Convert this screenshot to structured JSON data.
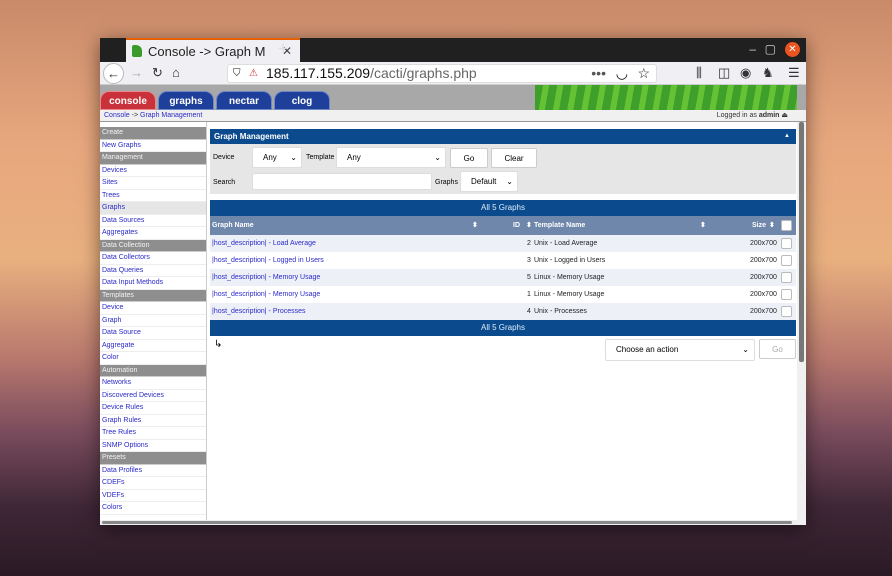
{
  "browser": {
    "tab_title": "Console -> Graph M",
    "url_host": "185.117.155.209",
    "url_path": "/cacti/graphs.php"
  },
  "cacti_tabs": [
    "console",
    "graphs",
    "nectar",
    "clog"
  ],
  "breadcrumb": {
    "root": "Console",
    "sep": "->",
    "current": "Graph Management"
  },
  "logged_in": {
    "prefix": "Logged in as",
    "user": "admin"
  },
  "sidebar": [
    {
      "type": "sec",
      "label": "Create"
    },
    {
      "type": "it",
      "label": "New Graphs"
    },
    {
      "type": "sec",
      "label": "Management"
    },
    {
      "type": "it",
      "label": "Devices"
    },
    {
      "type": "it",
      "label": "Sites"
    },
    {
      "type": "it",
      "label": "Trees"
    },
    {
      "type": "sel",
      "label": "Graphs"
    },
    {
      "type": "it",
      "label": "Data Sources"
    },
    {
      "type": "it",
      "label": "Aggregates"
    },
    {
      "type": "sec",
      "label": "Data Collection"
    },
    {
      "type": "it",
      "label": "Data Collectors"
    },
    {
      "type": "it",
      "label": "Data Queries"
    },
    {
      "type": "it",
      "label": "Data Input Methods"
    },
    {
      "type": "sec",
      "label": "Templates"
    },
    {
      "type": "it",
      "label": "Device"
    },
    {
      "type": "it",
      "label": "Graph"
    },
    {
      "type": "it",
      "label": "Data Source"
    },
    {
      "type": "it",
      "label": "Aggregate"
    },
    {
      "type": "it",
      "label": "Color"
    },
    {
      "type": "sec",
      "label": "Automation"
    },
    {
      "type": "it",
      "label": "Networks"
    },
    {
      "type": "it",
      "label": "Discovered Devices"
    },
    {
      "type": "it",
      "label": "Device Rules"
    },
    {
      "type": "it",
      "label": "Graph Rules"
    },
    {
      "type": "it",
      "label": "Tree Rules"
    },
    {
      "type": "it",
      "label": "SNMP Options"
    },
    {
      "type": "sec",
      "label": "Presets"
    },
    {
      "type": "it",
      "label": "Data Profiles"
    },
    {
      "type": "it",
      "label": "CDEFs"
    },
    {
      "type": "it",
      "label": "VDEFs"
    },
    {
      "type": "it",
      "label": "Colors"
    }
  ],
  "panel": {
    "title": "Graph Management",
    "device_label": "Device",
    "device_value": "Any",
    "template_label": "Template",
    "template_value": "Any",
    "go": "Go",
    "clear": "Clear",
    "search_label": "Search",
    "search_value": "",
    "graphs_label": "Graphs",
    "graphs_value": "Default"
  },
  "summary": "All 5 Graphs",
  "columns": {
    "name": "Graph Name",
    "id": "ID",
    "template": "Template Name",
    "size": "Size"
  },
  "rows": [
    {
      "name": "|host_description| - Load Average",
      "id": "2",
      "template": "Unix - Load Average",
      "size": "200x700"
    },
    {
      "name": "|host_description| - Logged in Users",
      "id": "3",
      "template": "Unix - Logged in Users",
      "size": "200x700"
    },
    {
      "name": "|host_description| - Memory Usage",
      "id": "5",
      "template": "Linux - Memory Usage",
      "size": "200x700"
    },
    {
      "name": "|host_description| - Memory Usage",
      "id": "1",
      "template": "Linux - Memory Usage",
      "size": "200x700"
    },
    {
      "name": "|host_description| - Processes",
      "id": "4",
      "template": "Unix - Processes",
      "size": "200x700"
    }
  ],
  "action": {
    "placeholder": "Choose an action",
    "go": "Go"
  }
}
